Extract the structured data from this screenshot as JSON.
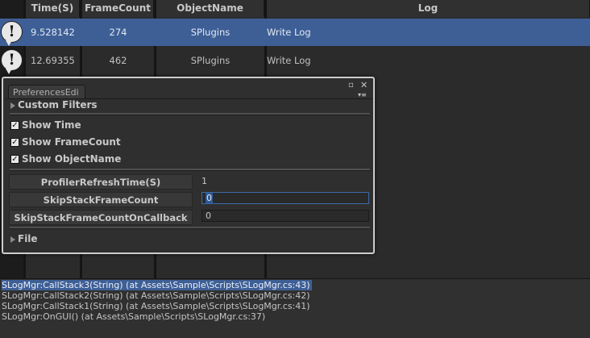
{
  "log_table": {
    "columns": [
      "Time(S)",
      "FrameCount",
      "ObjectName",
      "Log"
    ],
    "rows": [
      {
        "time": "9.528142",
        "frame": "274",
        "object": "SPlugins",
        "log": "Write Log",
        "selected": true,
        "icon": "message-bubble-icon"
      },
      {
        "time": "12.69355",
        "frame": "462",
        "object": "SPlugins",
        "log": "Write Log",
        "selected": false,
        "icon": "message-bubble-icon"
      }
    ]
  },
  "preferences": {
    "tab_title": "PreferencesEdi",
    "window_buttons": {
      "maximize": "▫",
      "close": "✕",
      "menu": "▾≡"
    },
    "custom_filters_label": "Custom Filters",
    "checkboxes": [
      {
        "label": "Show Time",
        "checked": true
      },
      {
        "label": "Show FrameCount",
        "checked": true
      },
      {
        "label": "Show ObjectName",
        "checked": true
      }
    ],
    "properties": [
      {
        "label": "ProfilerRefreshTime(S)",
        "value": "1"
      },
      {
        "label": "SkipStackFrameCount",
        "value": "0"
      },
      {
        "label": "SkipStackFrameCountOnCallback",
        "value": "0"
      }
    ],
    "file_label": "File"
  },
  "stack_trace": [
    {
      "text": "SLogMgr:CallStack3(String) (at Assets\\Sample\\Scripts\\SLogMgr.cs:43)",
      "selected": true
    },
    {
      "text": "SLogMgr:CallStack2(String) (at Assets\\Sample\\Scripts\\SLogMgr.cs:42)",
      "selected": false
    },
    {
      "text": "SLogMgr:CallStack1(String) (at Assets\\Sample\\Scripts\\SLogMgr.cs:41)",
      "selected": false
    },
    {
      "text": "SLogMgr:OnGUI() (at Assets\\Sample\\Scripts\\SLogMgr.cs:37)",
      "selected": false
    }
  ],
  "colors": {
    "selection": "#3e5f96",
    "background": "#1c1c1c",
    "panel": "#2f2f2f",
    "header": "#303030"
  }
}
